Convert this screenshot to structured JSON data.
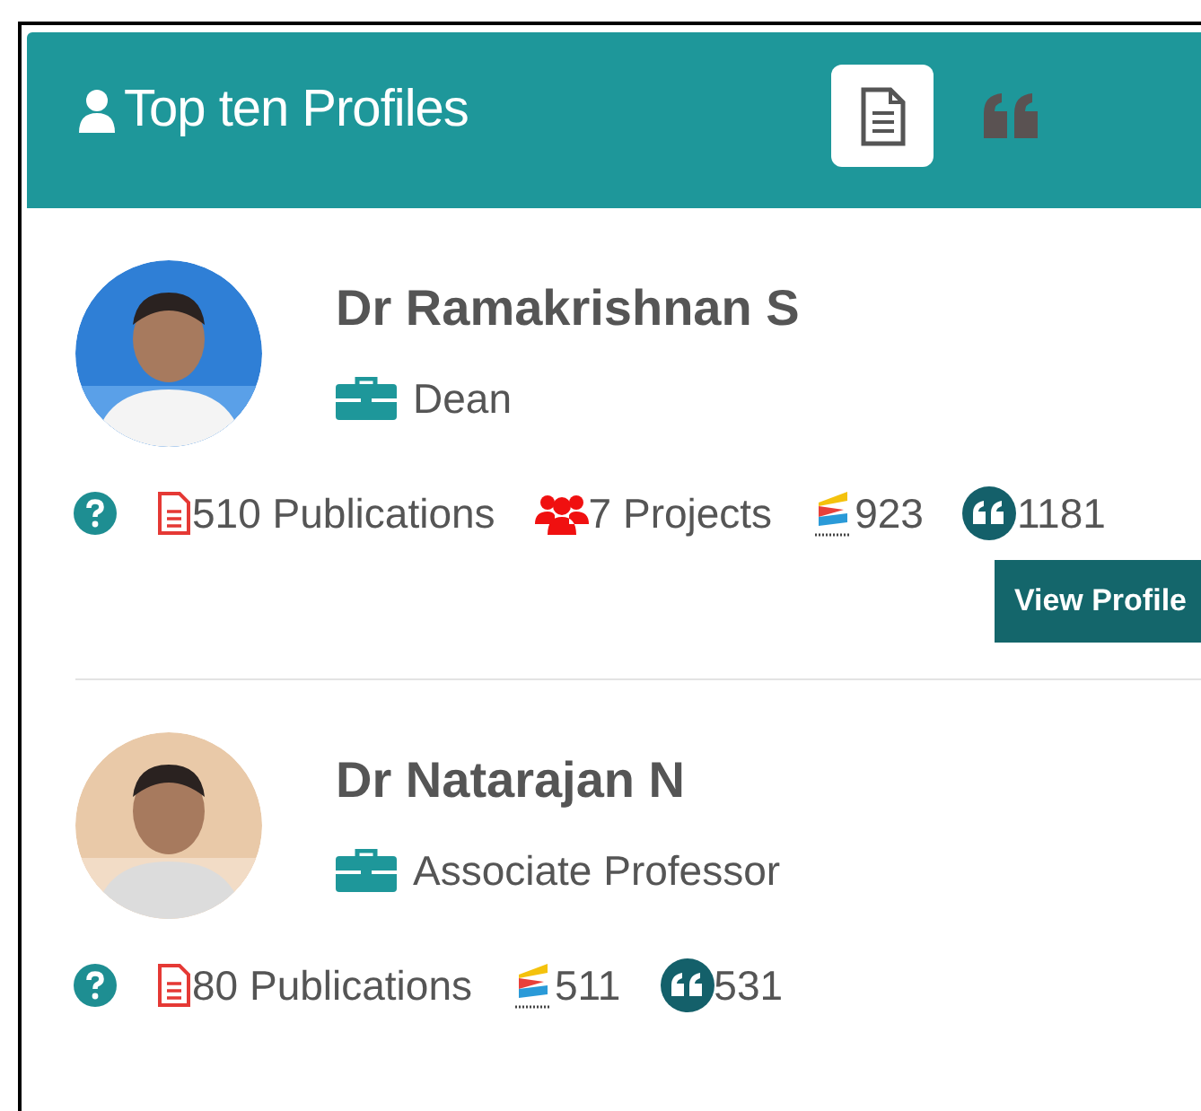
{
  "panel": {
    "title": "Top ten Profiles"
  },
  "tabs": [
    {
      "kind": "document",
      "selected": true
    },
    {
      "kind": "quote",
      "selected": false
    }
  ],
  "profiles": [
    {
      "name": "Dr Ramakrishnan S",
      "role": "Dean",
      "stats": [
        {
          "kind": "publications",
          "text": "510 Publications"
        },
        {
          "kind": "projects",
          "text": "7 Projects"
        },
        {
          "kind": "score",
          "text": "923"
        },
        {
          "kind": "citations",
          "text": "1181"
        }
      ],
      "button": "View Profile"
    },
    {
      "name": "Dr Natarajan N",
      "role": "Associate Professor",
      "stats": [
        {
          "kind": "publications",
          "text": "80 Publications"
        },
        {
          "kind": "score",
          "text": "511"
        },
        {
          "kind": "citations",
          "text": "531"
        }
      ]
    }
  ]
}
